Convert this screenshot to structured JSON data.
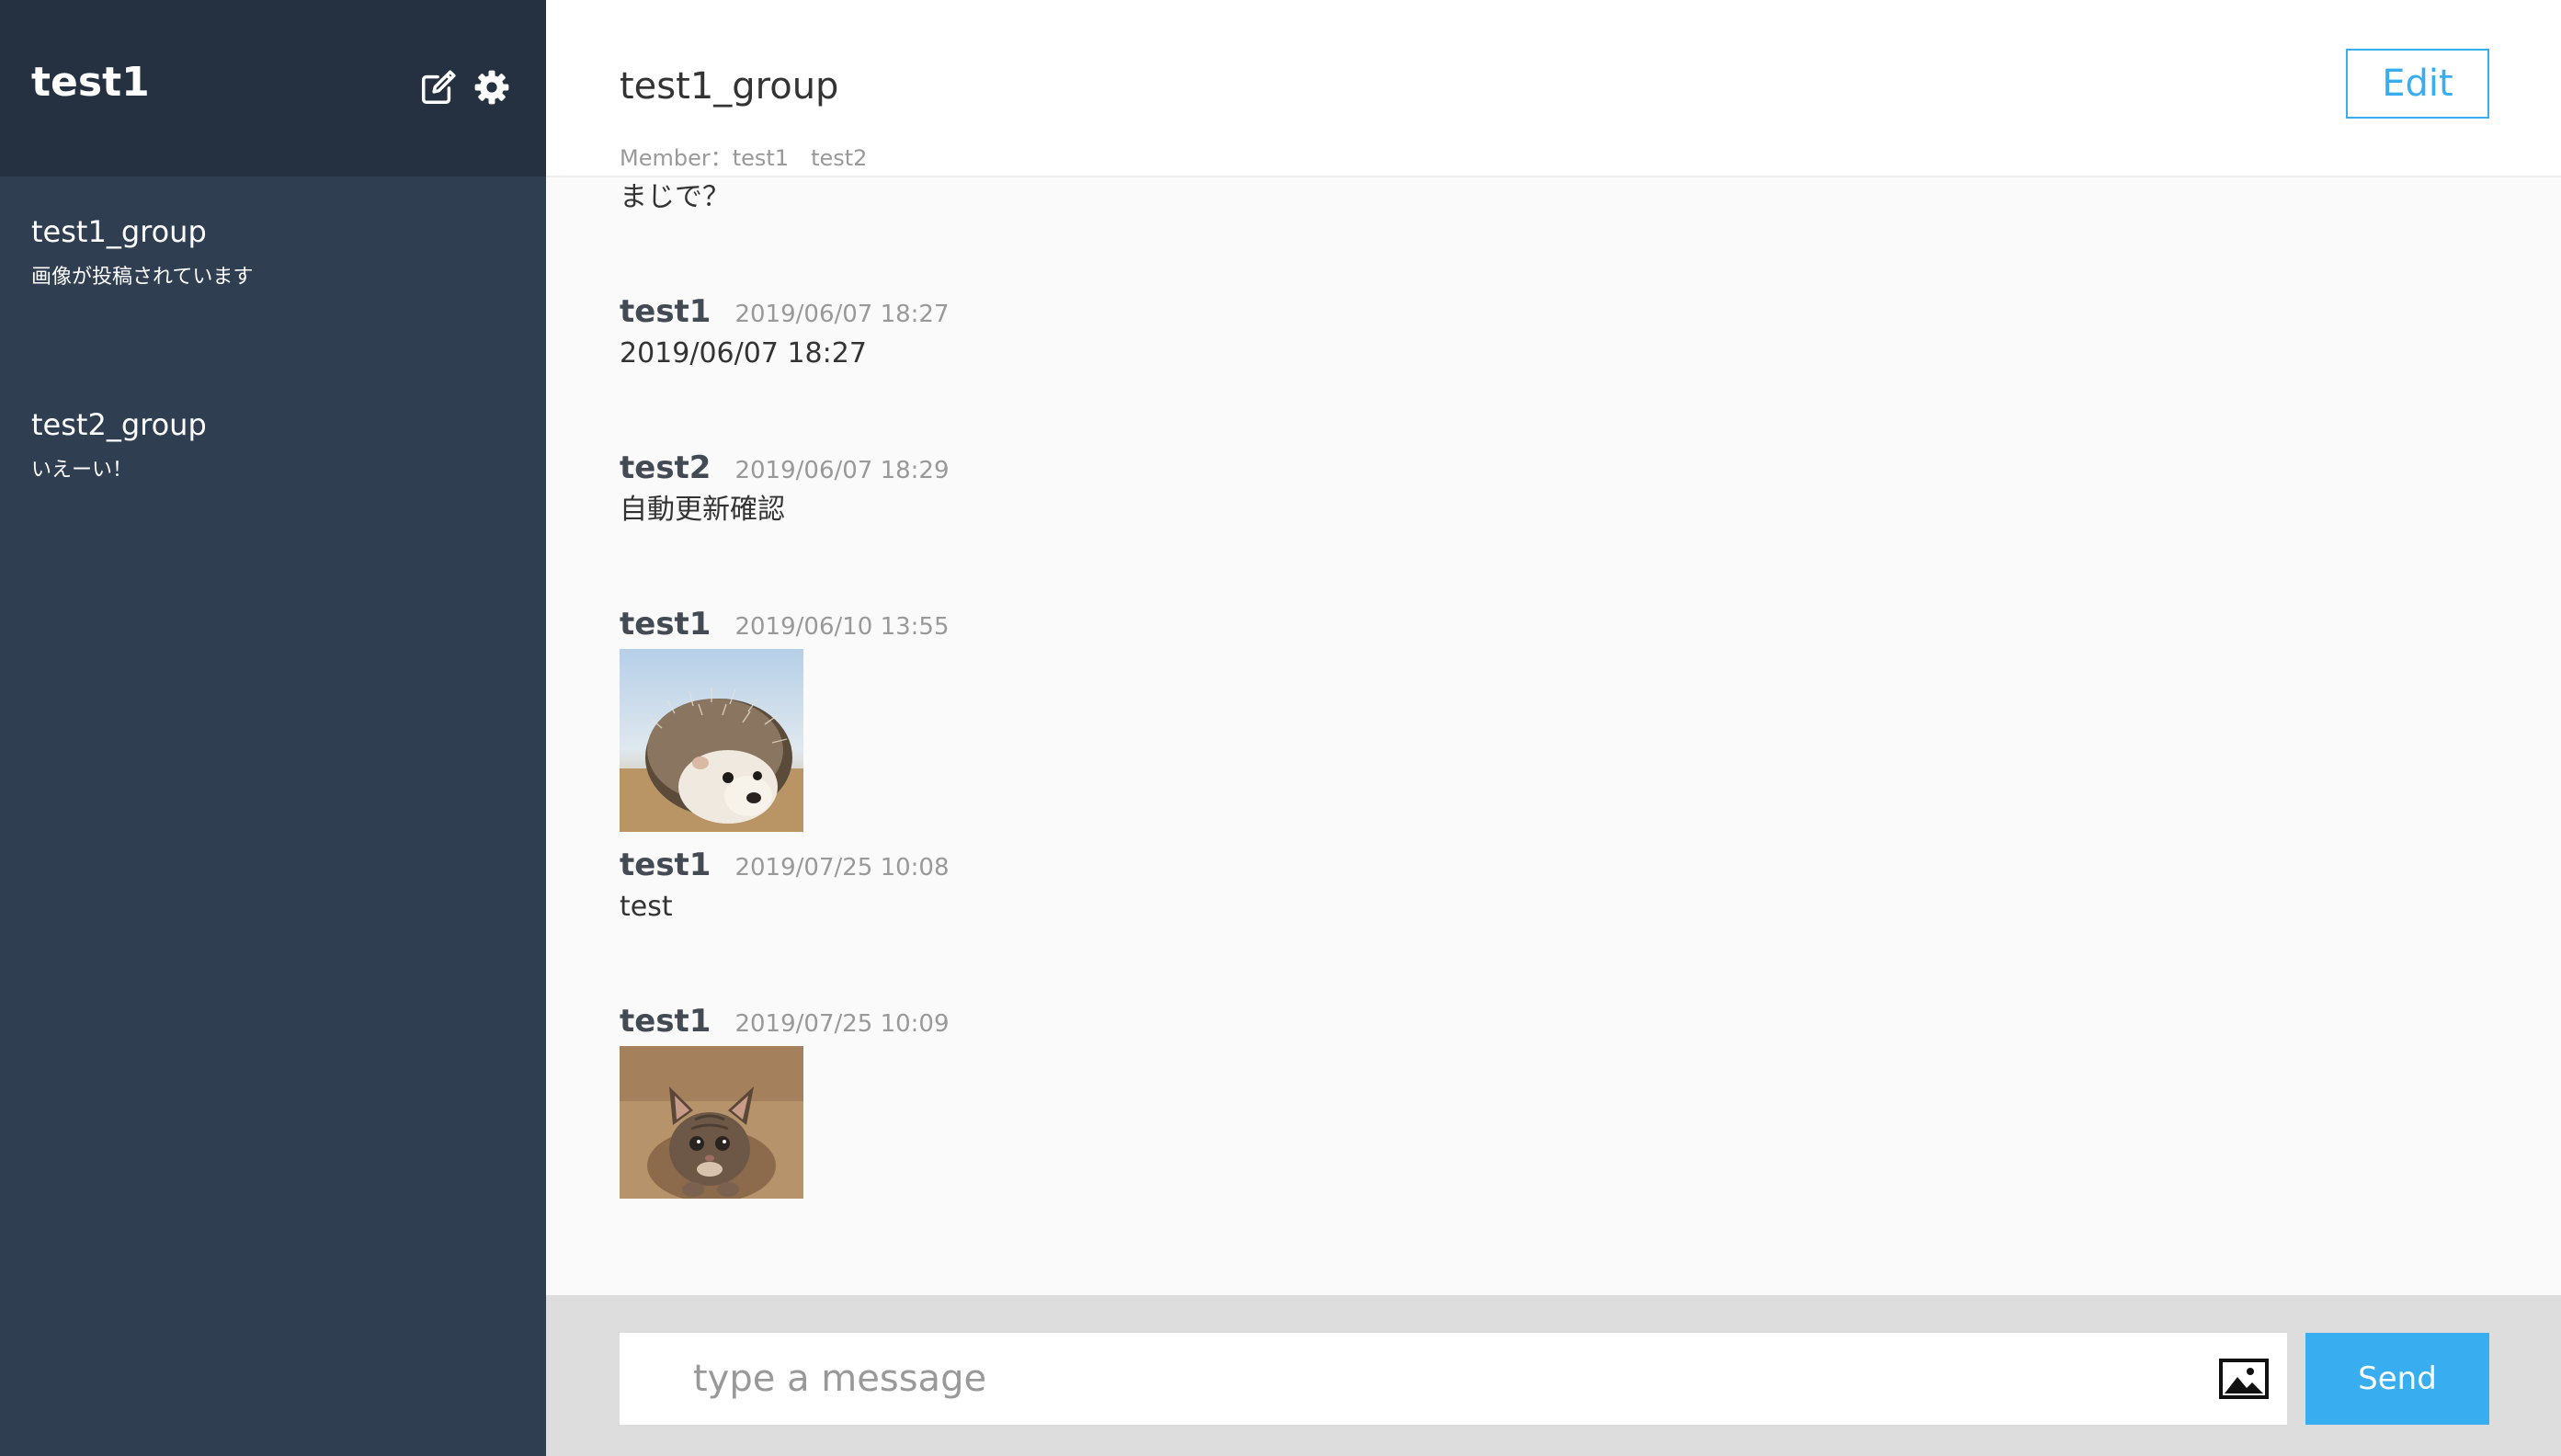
{
  "sidebar": {
    "user_name": "test1",
    "groups": [
      {
        "name": "test1_group",
        "last_message": "画像が投稿されています"
      },
      {
        "name": "test2_group",
        "last_message": "いえーい！"
      }
    ]
  },
  "header": {
    "group_name": "test1_group",
    "member_line": "Member：test1　test2",
    "edit_label": "Edit"
  },
  "messages": [
    {
      "user": "",
      "date": "",
      "text": "まじで？",
      "image": ""
    },
    {
      "user": "test1",
      "date": "2019/06/07 18:27",
      "text": "2019/06/07 18:27",
      "image": ""
    },
    {
      "user": "test2",
      "date": "2019/06/07 18:29",
      "text": "自動更新確認",
      "image": ""
    },
    {
      "user": "test1",
      "date": "2019/06/10 13:55",
      "text": "",
      "image": "hedgehog photo"
    },
    {
      "user": "test1",
      "date": "2019/07/25 10:08",
      "text": "test",
      "image": ""
    },
    {
      "user": "test1",
      "date": "2019/07/25 10:09",
      "text": "",
      "image": "kitten photo"
    }
  ],
  "form": {
    "placeholder": "type a message",
    "value": "",
    "send_label": "Send"
  },
  "icons": {
    "edit": "edit-icon",
    "settings": "gear-icon",
    "image_upload": "image-icon"
  },
  "colors": {
    "sidebar": "#2f3e51",
    "sidebar_header": "#253141",
    "accent": "#38aef0"
  }
}
